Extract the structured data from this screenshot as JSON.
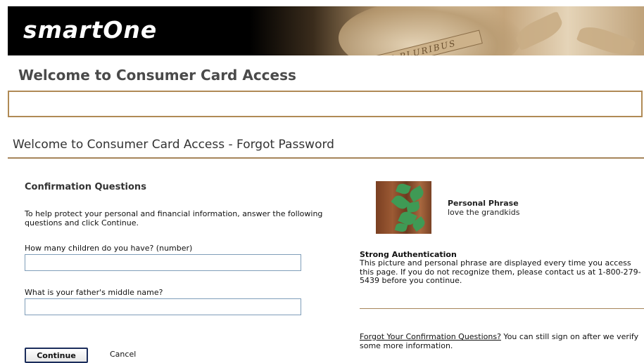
{
  "header": {
    "brand": "smartOne",
    "banner_ribbon": "E PLURIBUS"
  },
  "page": {
    "welcome_title": "Welcome to Consumer Card Access",
    "subheading": "Welcome to Consumer Card Access - Forgot Password"
  },
  "form": {
    "section_title": "Confirmation Questions",
    "intro": "To help protect your personal and financial information, answer the following questions and click Continue.",
    "question1": "How many children do you have? (number)",
    "question1_value": "",
    "question2": "What is your father's middle name?",
    "question2_value": "",
    "continue_label": "Continue",
    "cancel_label": "Cancel"
  },
  "security": {
    "phrase_label": "Personal Phrase",
    "phrase_value": "love the grandkids",
    "strong_title": "Strong Authentication",
    "strong_text": "This picture and personal phrase are displayed every time you access this page. If you do not recognize them, please contact us at 1-800-279-5439 before you continue.",
    "forgot_link": "Forgot Your Confirmation Questions?",
    "forgot_text": " You can still sign on after we verify some more information."
  },
  "colors": {
    "accent_rule": "#a6855a",
    "button_border": "#1b2d5b"
  }
}
